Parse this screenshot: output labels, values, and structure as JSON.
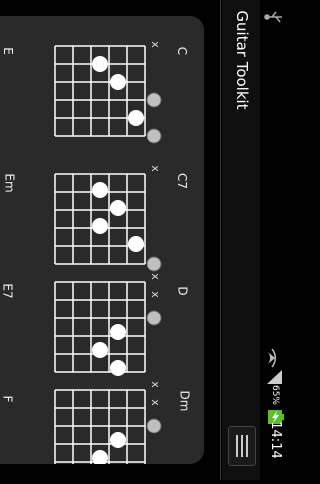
{
  "app": {
    "title": "Guitar Toolkit"
  },
  "status_bar": {
    "time": "14:14",
    "battery_percent": "65%",
    "usb_icon": "usb-icon",
    "signal_icon": "signal-icon",
    "wifi_icon": "wifi-icon",
    "battery_icon": "battery-icon"
  },
  "toolbar": {
    "menu_icon": "menu-icon"
  },
  "chords": [
    {
      "name": "C",
      "fret_label": "E",
      "mutes": [
        "x"
      ]
    },
    {
      "name": "C7",
      "fret_label": "Em",
      "mutes": [
        "x"
      ]
    },
    {
      "name": "D",
      "fret_label": "E7",
      "mutes": [
        "x",
        "x"
      ]
    },
    {
      "name": "Dm",
      "fret_label": "F",
      "mutes": [
        "x",
        "x"
      ]
    }
  ],
  "colors": {
    "background": "#000000",
    "panel": "#2a2a2a",
    "grid": "#ffffff",
    "dot": "#ffffff",
    "open_dot": "#bfbfbf"
  }
}
